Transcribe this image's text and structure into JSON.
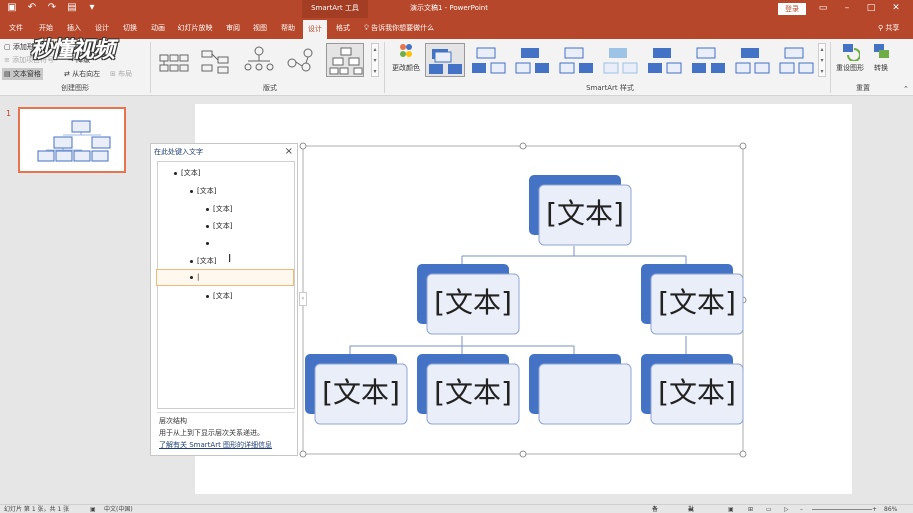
{
  "titlebar": {
    "context_title": "SmartArt 工具",
    "doc_title": "演示文稿1 - PowerPoint",
    "login": "登录",
    "qat_icons": [
      "save-icon",
      "undo-icon",
      "redo-icon",
      "start-slideshow-icon",
      "customize-icon"
    ]
  },
  "tabs": [
    {
      "label": "文件"
    },
    {
      "label": "开始"
    },
    {
      "label": "插入"
    },
    {
      "label": "设计"
    },
    {
      "label": "切换"
    },
    {
      "label": "动画"
    },
    {
      "label": "幻灯片放映"
    },
    {
      "label": "审阅"
    },
    {
      "label": "视图"
    },
    {
      "label": "帮助"
    },
    {
      "label": "设计"
    },
    {
      "label": "格式"
    }
  ],
  "tellme": "告诉我你想要做什么",
  "share": "共享",
  "ribbon": {
    "create": {
      "add_shape": "添加形",
      "add_bullet": "添加项目符号",
      "text_pane": "文本窗格",
      "demote": "降级",
      "rtl": "从右向左",
      "layout": "布局",
      "label": "创建图形"
    },
    "layouts_label": "版式",
    "change_colors": "更改颜色",
    "styles_label": "SmartArt 样式",
    "reset_graphic": "重设图形",
    "convert": "转换",
    "reset_label": "重置"
  },
  "slide_number": "1",
  "text_pane": {
    "title": "在此处键入文字",
    "close": "×",
    "items": [
      {
        "level": 0,
        "text": "[文本]"
      },
      {
        "level": 1,
        "text": "[文本]"
      },
      {
        "level": 2,
        "text": "[文本]"
      },
      {
        "level": 2,
        "text": "[文本]"
      },
      {
        "level": 2,
        "text": ""
      },
      {
        "level": 1,
        "text": "[文本]"
      },
      {
        "level": 1,
        "text": "|"
      },
      {
        "level": 2,
        "text": "[文本]"
      }
    ],
    "footer_title": "层次结构",
    "footer_desc": "用于从上到下显示层次关系递进。",
    "footer_link": "了解有关 SmartArt 图形的详细信息"
  },
  "smartart": {
    "nodes": [
      "[文本]",
      "[文本]",
      "[文本]",
      "[文本]",
      "[文本]",
      "",
      "[文本]"
    ]
  },
  "statusbar": {
    "slide_info": "幻灯片 第 1 张，共 1 张",
    "language": "中文(中国)",
    "notes": "备注",
    "comments": "批注",
    "zoom": "86%"
  },
  "watermark": "秒懂视频",
  "colors": {
    "accent": "#b7472a",
    "node_blue": "#4472c4",
    "node_fill": "#e9eef8"
  }
}
